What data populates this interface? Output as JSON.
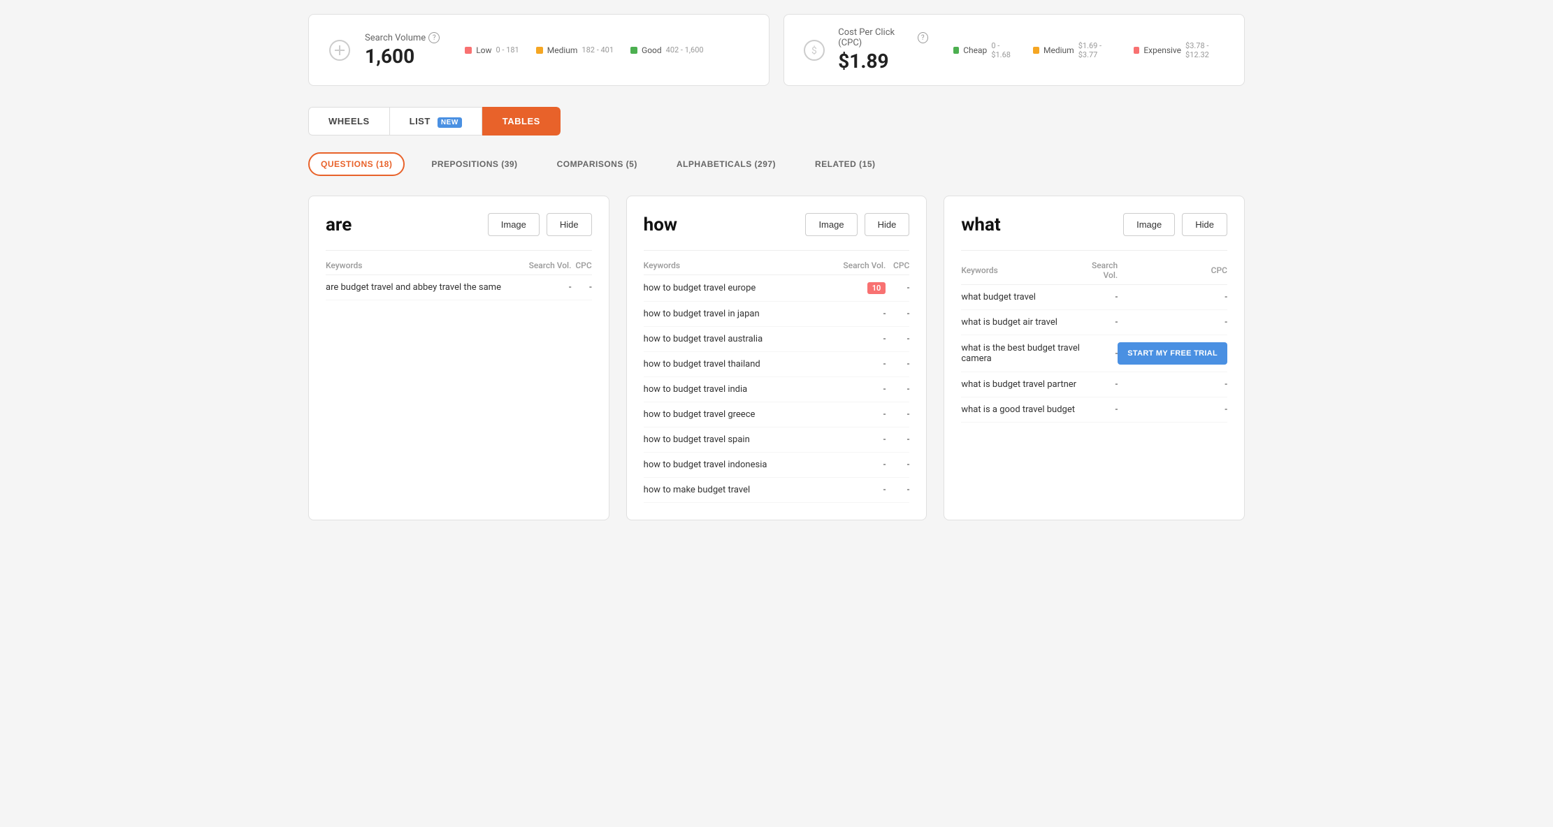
{
  "stats": {
    "searchVolume": {
      "label": "Search Volume",
      "value": "1,600",
      "legend": [
        {
          "color": "#f87171",
          "label": "Low",
          "range": "0 - 181"
        },
        {
          "color": "#f5a623",
          "label": "Medium",
          "range": "182 - 401"
        },
        {
          "color": "#4caf50",
          "label": "Good",
          "range": "402 - 1,600"
        }
      ]
    },
    "cpc": {
      "label": "Cost Per Click (CPC)",
      "value": "$1.89",
      "legend": [
        {
          "color": "#4caf50",
          "label": "Cheap",
          "range": "0 - $1.68"
        },
        {
          "color": "#f5a623",
          "label": "Medium",
          "range": "$1.69 - $3.77"
        },
        {
          "color": "#f87171",
          "label": "Expensive",
          "range": "$3.78 - $12.32"
        }
      ]
    }
  },
  "tabs": [
    {
      "id": "wheels",
      "label": "WHEELS",
      "active": false,
      "badge": null
    },
    {
      "id": "list",
      "label": "LIST",
      "active": false,
      "badge": "NEW"
    },
    {
      "id": "tables",
      "label": "TABLES",
      "active": true,
      "badge": null
    }
  ],
  "filters": [
    {
      "id": "questions",
      "label": "QUESTIONS (18)",
      "active": true
    },
    {
      "id": "prepositions",
      "label": "PREPOSITIONS (39)",
      "active": false
    },
    {
      "id": "comparisons",
      "label": "COMPARISONS (5)",
      "active": false
    },
    {
      "id": "alphabeticals",
      "label": "ALPHABETICALS (297)",
      "active": false
    },
    {
      "id": "related",
      "label": "RELATED (15)",
      "active": false
    }
  ],
  "cards": [
    {
      "id": "are",
      "word": "are",
      "imageBtn": "Image",
      "hideBtn": "Hide",
      "columns": [
        "Keywords",
        "Search Vol.",
        "CPC"
      ],
      "rows": [
        {
          "keyword": "are budget travel and abbey travel the same",
          "vol": "-",
          "cpc": "-",
          "volHighlight": false
        }
      ]
    },
    {
      "id": "how",
      "word": "how",
      "imageBtn": "Image",
      "hideBtn": "Hide",
      "columns": [
        "Keywords",
        "Search Vol.",
        "CPC"
      ],
      "rows": [
        {
          "keyword": "how to budget travel europe",
          "vol": "10",
          "cpc": "-",
          "volHighlight": true
        },
        {
          "keyword": "how to budget travel in japan",
          "vol": "-",
          "cpc": "-",
          "volHighlight": false
        },
        {
          "keyword": "how to budget travel australia",
          "vol": "-",
          "cpc": "-",
          "volHighlight": false
        },
        {
          "keyword": "how to budget travel thailand",
          "vol": "-",
          "cpc": "-",
          "volHighlight": false
        },
        {
          "keyword": "how to budget travel india",
          "vol": "-",
          "cpc": "-",
          "volHighlight": false
        },
        {
          "keyword": "how to budget travel greece",
          "vol": "-",
          "cpc": "-",
          "volHighlight": false
        },
        {
          "keyword": "how to budget travel spain",
          "vol": "-",
          "cpc": "-",
          "volHighlight": false
        },
        {
          "keyword": "how to budget travel indonesia",
          "vol": "-",
          "cpc": "-",
          "volHighlight": false
        },
        {
          "keyword": "how to make budget travel",
          "vol": "-",
          "cpc": "-",
          "volHighlight": false
        }
      ]
    },
    {
      "id": "what",
      "word": "what",
      "imageBtn": "Image",
      "hideBtn": "Hide",
      "columns": [
        "Keywords",
        "Search Vol.",
        "CPC"
      ],
      "rows": [
        {
          "keyword": "what budget travel",
          "vol": "-",
          "cpc": "-",
          "volHighlight": false,
          "showTrial": false
        },
        {
          "keyword": "what is budget air travel",
          "vol": "-",
          "cpc": "-",
          "volHighlight": false,
          "showTrial": false
        },
        {
          "keyword": "what is the best budget travel camera",
          "vol": "-",
          "cpc": "-",
          "volHighlight": false,
          "showTrial": true
        },
        {
          "keyword": "what is budget travel partner",
          "vol": "-",
          "cpc": "-",
          "volHighlight": false,
          "showTrial": false
        },
        {
          "keyword": "what is a good travel budget",
          "vol": "-",
          "cpc": "-",
          "volHighlight": false,
          "showTrial": false
        }
      ]
    }
  ],
  "trialBtn": "START MY FREE TRIAL"
}
